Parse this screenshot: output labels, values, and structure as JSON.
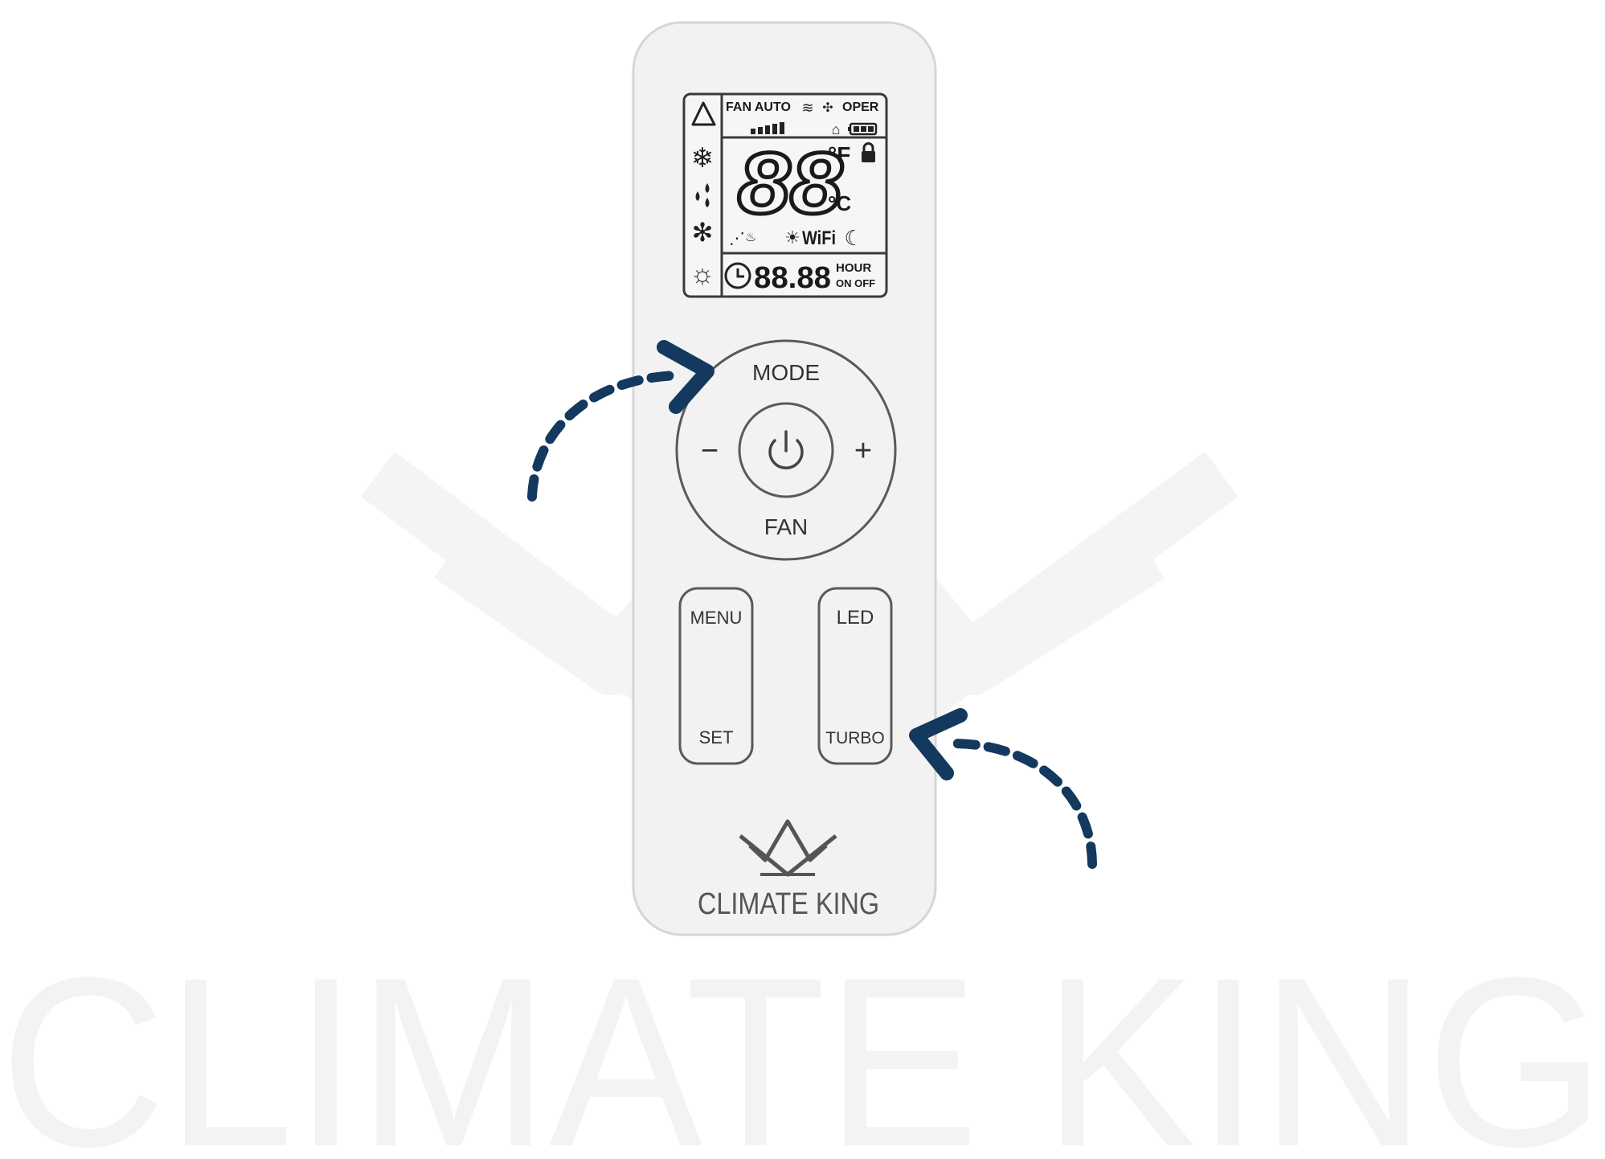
{
  "watermark": {
    "text": "CLIMATE KING"
  },
  "lcd": {
    "fan_label": "FAN AUTO",
    "oper_label": "OPER",
    "temperature": "88",
    "unit_f": "°F",
    "unit_c": "°C",
    "wifi_label": "WiFi",
    "timer_value": "88.88",
    "hour_label": "HOUR",
    "on_off_label": "ON OFF"
  },
  "dial": {
    "mode_label": "MODE",
    "fan_label": "FAN",
    "minus_label": "−",
    "plus_label": "+"
  },
  "buttons": {
    "menu_label": "MENU",
    "set_label": "SET",
    "led_label": "LED",
    "turbo_label": "TURBO"
  },
  "brand": {
    "name": "CLIMATE KING"
  },
  "colors": {
    "remote_body": "#f2f2f2",
    "outline": "#555555",
    "arrow": "#133a5e",
    "watermark": "#f4f4f4"
  }
}
